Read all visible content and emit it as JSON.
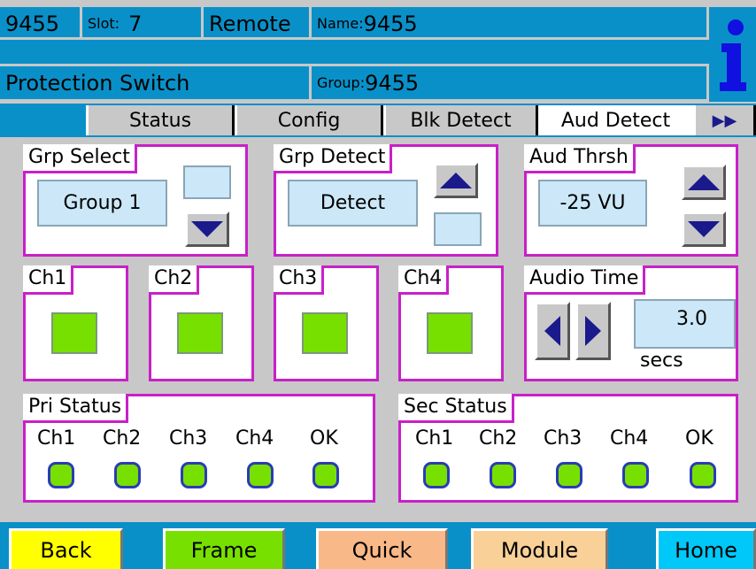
{
  "header": {
    "device_id": "9455",
    "slot_label": "Slot:",
    "slot_value": "7",
    "mode": "Remote",
    "name_label": "Name:",
    "name_value": "9455",
    "function": "Protection Switch",
    "group_label": "Group:",
    "group_value": "9455",
    "info_icon": "info-icon"
  },
  "tabs": [
    {
      "label": "Status",
      "active": false
    },
    {
      "label": "Config",
      "active": false
    },
    {
      "label": "Blk Detect",
      "active": false
    },
    {
      "label": "Aud Detect",
      "active": true
    },
    {
      "label": "▶▶",
      "active": false
    }
  ],
  "grp_select": {
    "title": "Grp Select",
    "value": "Group 1"
  },
  "grp_detect": {
    "title": "Grp Detect",
    "value": "Detect"
  },
  "aud_thrsh": {
    "title": "Aud Thrsh",
    "value": "-25 VU"
  },
  "channels": [
    {
      "label": "Ch1",
      "color": "#78e000"
    },
    {
      "label": "Ch2",
      "color": "#78e000"
    },
    {
      "label": "Ch3",
      "color": "#78e000"
    },
    {
      "label": "Ch4",
      "color": "#78e000"
    }
  ],
  "audio_time": {
    "title": "Audio Time",
    "value": "3.0",
    "unit": "secs"
  },
  "pri_status": {
    "title": "Pri Status",
    "items": [
      {
        "label": "Ch1",
        "color": "#78e000"
      },
      {
        "label": "Ch2",
        "color": "#78e000"
      },
      {
        "label": "Ch3",
        "color": "#78e000"
      },
      {
        "label": "Ch4",
        "color": "#78e000"
      },
      {
        "label": "OK",
        "color": "#78e000"
      }
    ]
  },
  "sec_status": {
    "title": "Sec Status",
    "items": [
      {
        "label": "Ch1",
        "color": "#78e000"
      },
      {
        "label": "Ch2",
        "color": "#78e000"
      },
      {
        "label": "Ch3",
        "color": "#78e000"
      },
      {
        "label": "Ch4",
        "color": "#78e000"
      },
      {
        "label": "OK",
        "color": "#78e000"
      }
    ]
  },
  "nav": [
    {
      "label": "Back",
      "color": "#ffff00"
    },
    {
      "label": "Frame",
      "color": "#78e000"
    },
    {
      "label": "Quick",
      "color": "#f8b888"
    },
    {
      "label": "Module",
      "color": "#f8d098"
    },
    {
      "label": "Home",
      "color": "#00c8f8"
    }
  ],
  "colors": {
    "header": "#0a90c8",
    "panel_border": "#c820c8",
    "field": "#cce8f8",
    "arrow": "#1a1a8c"
  }
}
